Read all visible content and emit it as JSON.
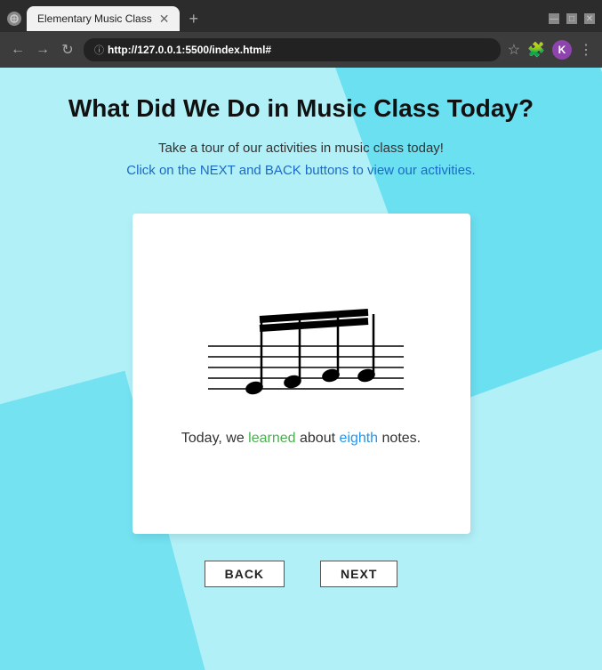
{
  "browser": {
    "tab_title": "Elementary Music Class",
    "url_prefix": "http://",
    "url_host": "127.0.0.1",
    "url_rest": ":5500/index.html#",
    "avatar_letter": "K"
  },
  "page": {
    "main_title": "What Did We Do in Music Class Today?",
    "subtitle": "Take a tour of our activities in music class today!",
    "instruction": "Click on the NEXT and BACK buttons to view our activities.",
    "caption_parts": {
      "prefix": "Today, we ",
      "word1": "learned",
      "mid1": " about ",
      "word2": "eighth",
      "suffix": " notes."
    }
  },
  "buttons": {
    "back_label": "BACK",
    "next_label": "NEXT"
  }
}
